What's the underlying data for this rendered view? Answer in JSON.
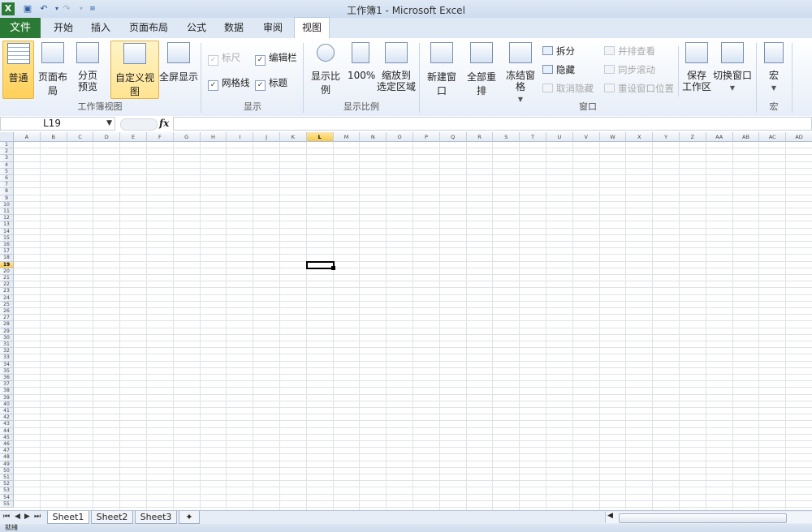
{
  "window": {
    "title": "工作簿1 - Microsoft Excel"
  },
  "tabs": {
    "file": "文件",
    "items": [
      "开始",
      "插入",
      "页面布局",
      "公式",
      "数据",
      "审阅",
      "视图"
    ],
    "active": "视图"
  },
  "ribbon": {
    "workbook_views": {
      "group": "工作簿视图",
      "normal": "普通",
      "page_layout": "页面布局",
      "page_break_1": "分页",
      "page_break_2": "预览",
      "custom_views": "自定义视图",
      "full_screen": "全屏显示"
    },
    "show": {
      "group": "显示",
      "ruler": "标尺",
      "formula_bar": "编辑栏",
      "gridlines": "网格线",
      "headings": "标题"
    },
    "zoom": {
      "group": "显示比例",
      "zoom": "显示比例",
      "zoom100": "100%",
      "zoom_sel_1": "缩放到",
      "zoom_sel_2": "选定区域"
    },
    "window": {
      "group": "窗口",
      "new_window": "新建窗口",
      "arrange_all": "全部重排",
      "freeze_panes": "冻结窗格",
      "split": "拆分",
      "hide": "隐藏",
      "unhide": "取消隐藏",
      "side_by_side": "并排查看",
      "sync_scroll": "同步滚动",
      "reset_position": "重设窗口位置",
      "save_ws_1": "保存",
      "save_ws_2": "工作区",
      "switch_windows": "切换窗口"
    },
    "macros": {
      "group": "宏",
      "macros": "宏"
    }
  },
  "formula_bar": {
    "name_box": "L19",
    "fx": "fx",
    "value": ""
  },
  "grid": {
    "columns": [
      "A",
      "B",
      "C",
      "D",
      "E",
      "F",
      "G",
      "H",
      "I",
      "J",
      "K",
      "L",
      "M",
      "N",
      "O",
      "P",
      "Q",
      "R",
      "S",
      "T",
      "U",
      "V",
      "W",
      "X",
      "Y",
      "Z",
      "AA",
      "AB",
      "AC",
      "AD"
    ],
    "row_count": 55,
    "selected_cell": "L19",
    "selected_column": "L",
    "selected_row": 19
  },
  "sheets": {
    "items": [
      "Sheet1",
      "Sheet2",
      "Sheet3"
    ],
    "active": "Sheet1"
  },
  "status": {
    "text": "就绪"
  },
  "colors": {
    "file_tab": "#2a7a35",
    "selection_header": "#f7c94a",
    "gridline": "#dfe3e8"
  }
}
